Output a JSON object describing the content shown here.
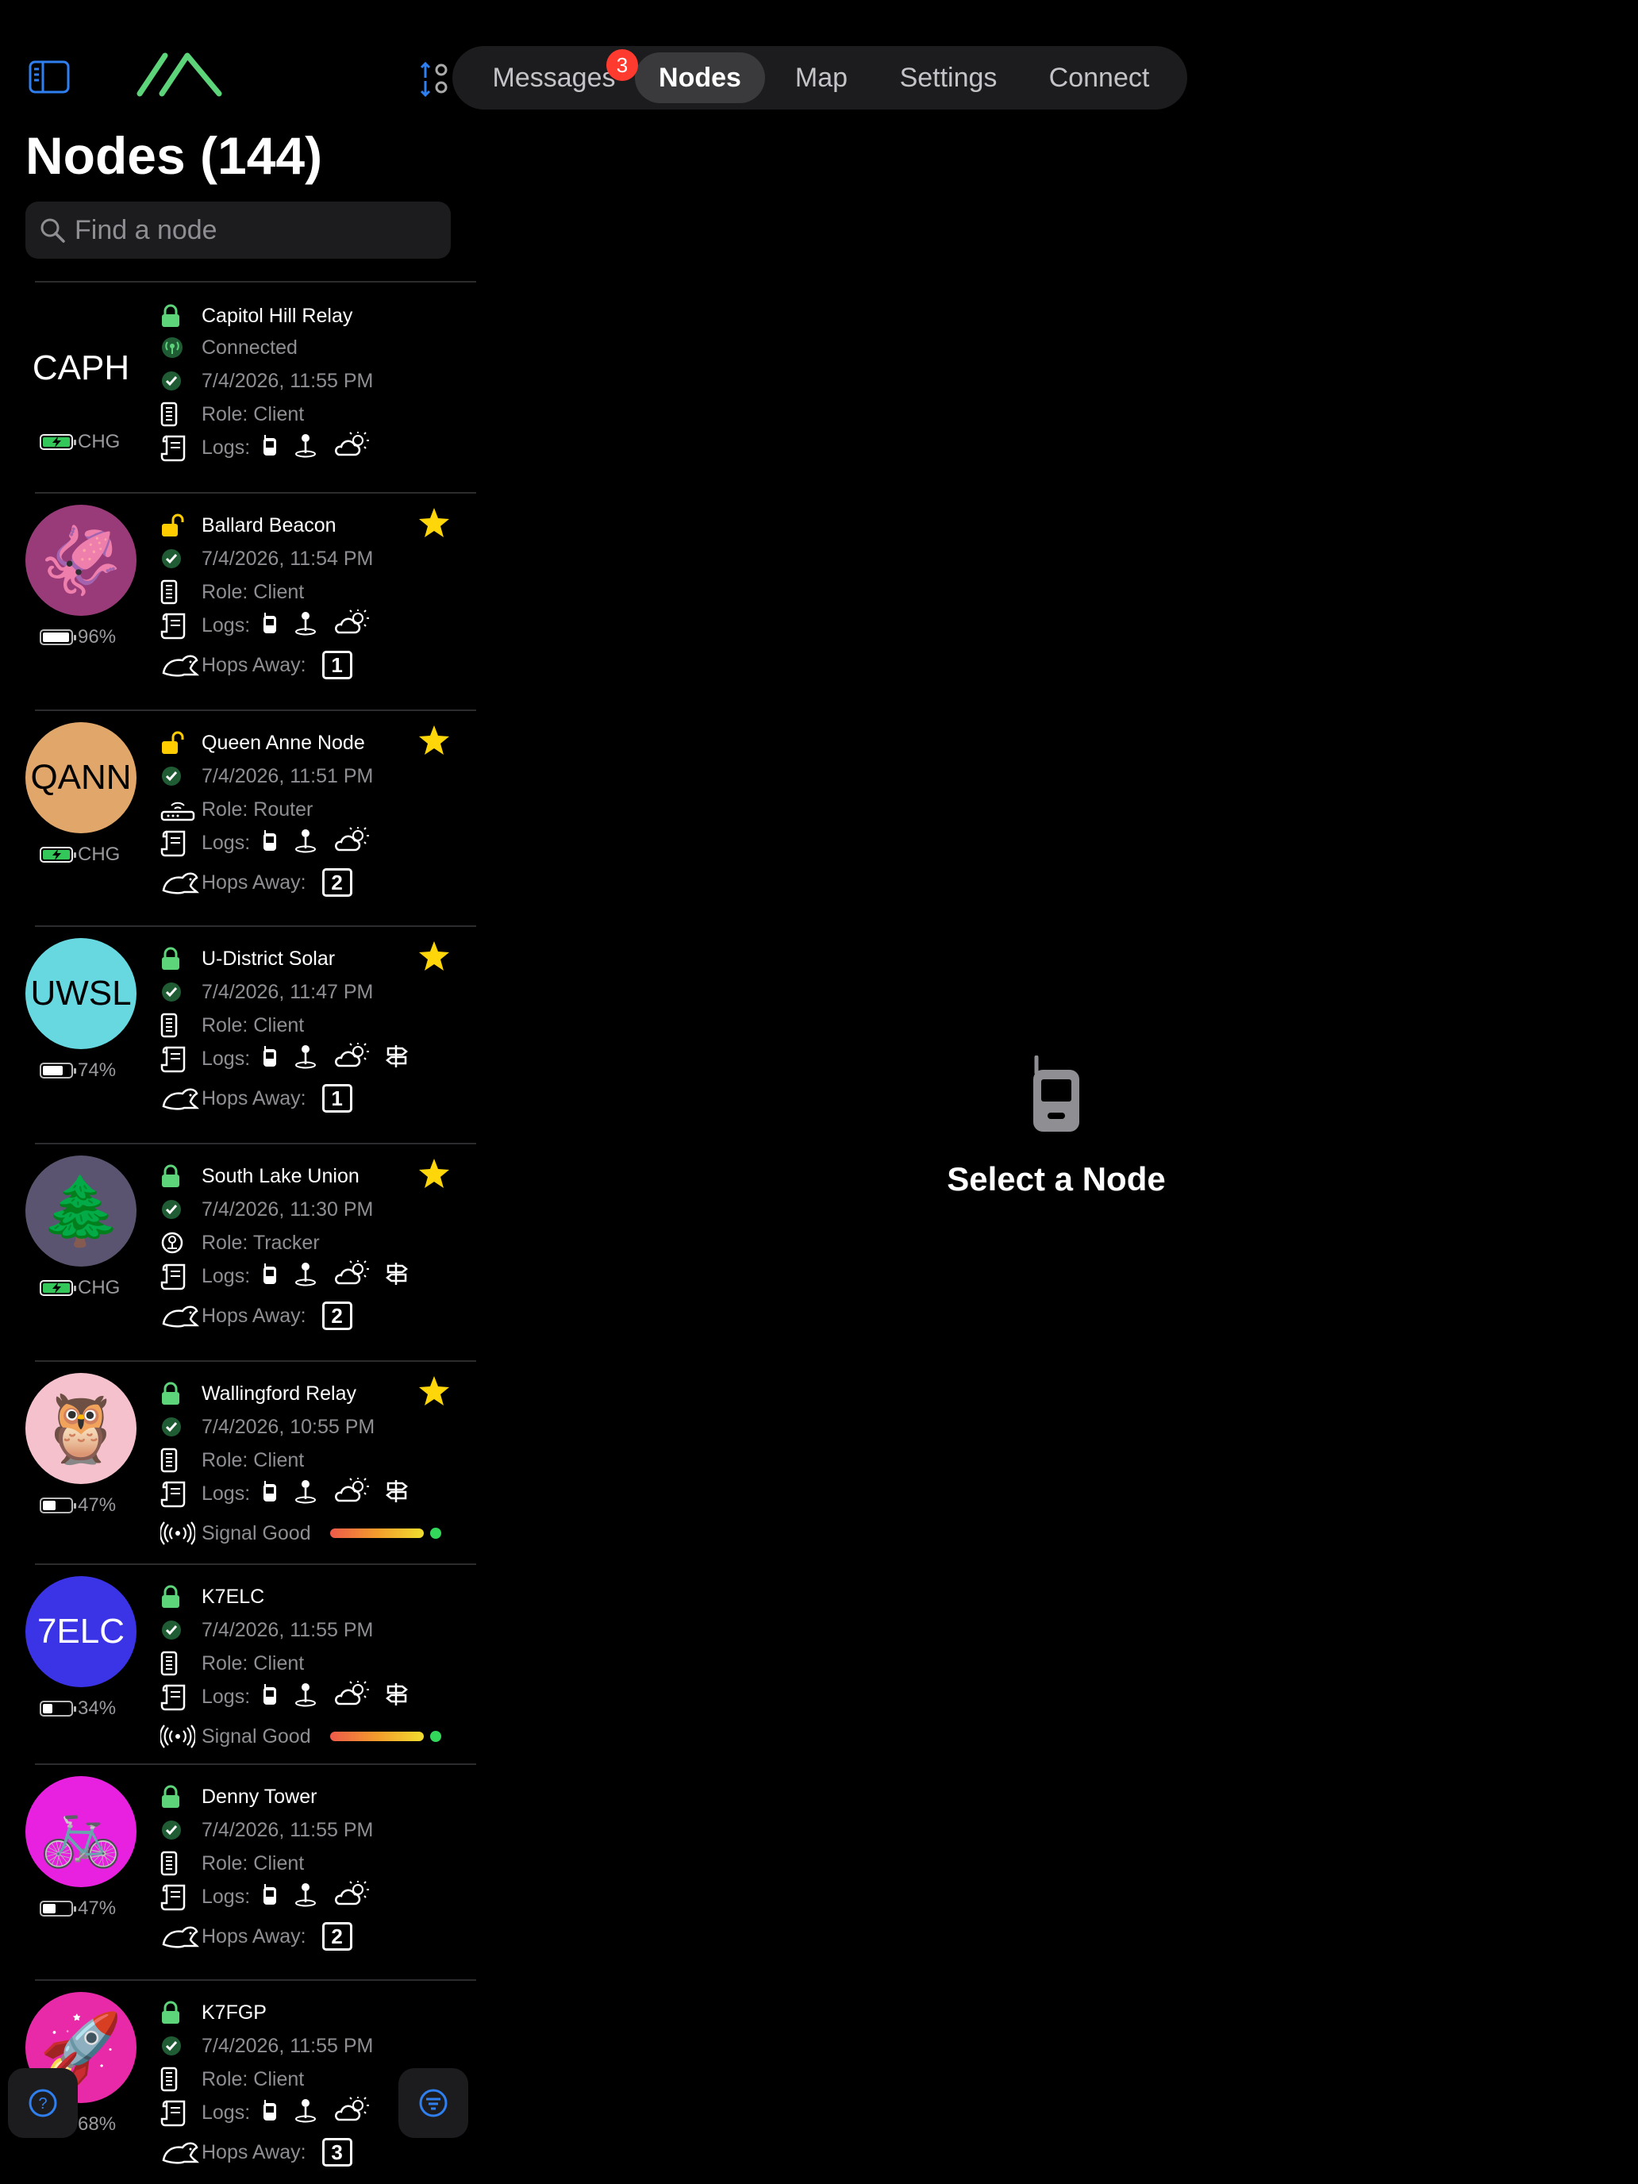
{
  "header": {
    "tabs": [
      {
        "label": "Messages",
        "badge": "3"
      },
      {
        "label": "Nodes"
      },
      {
        "label": "Map"
      },
      {
        "label": "Settings"
      },
      {
        "label": "Connect"
      }
    ],
    "active_tab": "Nodes"
  },
  "page_title": "Nodes (144)",
  "search": {
    "placeholder": "Find a node",
    "value": ""
  },
  "labels": {
    "logs": "Logs:",
    "hops_away": "Hops Away:",
    "signal_good": "Signal Good"
  },
  "nodes": [
    {
      "short": "CAPH",
      "name": "Capitol Hill Relay",
      "status": "Connected",
      "time": "7/4/2026, 11:55 PM",
      "role": "Role: Client",
      "battery": "CHG",
      "locked": true,
      "favorite": false,
      "avatar_color": "#000000",
      "logs": [
        "device",
        "position",
        "environment"
      ]
    },
    {
      "short": "🦑",
      "name": "Ballard Beacon",
      "time": "7/4/2026, 11:54 PM",
      "role": "Role: Client",
      "battery": "96%",
      "battery_level": 0.96,
      "locked": false,
      "favorite": true,
      "avatar_color": "#9a3b79",
      "logs": [
        "device",
        "position",
        "environment"
      ],
      "hops": "1"
    },
    {
      "short": "QANN",
      "name": "Queen Anne Node",
      "time": "7/4/2026, 11:51 PM",
      "role": "Role: Router",
      "battery": "CHG",
      "locked": false,
      "favorite": true,
      "avatar_color": "#e0a66a",
      "logs": [
        "device",
        "position",
        "environment"
      ],
      "hops": "2"
    },
    {
      "short": "UWSL",
      "name": "U-District Solar",
      "time": "7/4/2026, 11:47 PM",
      "role": "Role: Client",
      "battery": "74%",
      "battery_level": 0.74,
      "locked": true,
      "favorite": true,
      "avatar_color": "#67d8e0",
      "logs": [
        "device",
        "position",
        "environment",
        "trace"
      ],
      "hops": "1"
    },
    {
      "short": "🌲",
      "name": "South Lake Union",
      "time": "7/4/2026, 11:30 PM",
      "role": "Role: Tracker",
      "battery": "CHG",
      "locked": true,
      "favorite": true,
      "avatar_color": "#5a5470",
      "logs": [
        "device",
        "position",
        "environment",
        "trace"
      ],
      "hops": "2"
    },
    {
      "short": "🦉",
      "name": "Wallingford Relay",
      "time": "7/4/2026, 10:55 PM",
      "role": "Role: Client",
      "battery": "47%",
      "battery_level": 0.47,
      "locked": true,
      "favorite": true,
      "avatar_color": "#f4c1cd",
      "logs": [
        "device",
        "position",
        "environment",
        "trace"
      ],
      "signal": "Signal Good"
    },
    {
      "short": "7ELC",
      "name": "K7ELC",
      "time": "7/4/2026, 11:55 PM",
      "role": "Role: Client",
      "battery": "34%",
      "battery_level": 0.34,
      "locked": true,
      "favorite": false,
      "avatar_color": "#3a34e6",
      "logs": [
        "device",
        "position",
        "environment",
        "trace"
      ],
      "signal": "Signal Good"
    },
    {
      "short": "🚲",
      "name": "Denny Tower",
      "time": "7/4/2026, 11:55 PM",
      "role": "Role: Client",
      "battery": "47%",
      "battery_level": 0.47,
      "locked": true,
      "favorite": false,
      "avatar_color": "#e820e0",
      "logs": [
        "device",
        "position",
        "environment"
      ],
      "hops": "2"
    },
    {
      "short": "🚀",
      "name": "K7FGP",
      "time": "7/4/2026, 11:55 PM",
      "role": "Role: Client",
      "battery": "68%",
      "battery_level": 0.68,
      "locked": true,
      "favorite": false,
      "avatar_color": "#e82aa8",
      "logs": [
        "device",
        "position",
        "environment"
      ],
      "hops": "3"
    }
  ],
  "detail": {
    "placeholder": "Select a Node"
  },
  "colors": {
    "accent": "#2f7ff0",
    "lock_green": "#5dd37a",
    "lock_yellow": "#ffcc00",
    "star": "#ffd60a",
    "badge": "#ff3b30"
  }
}
